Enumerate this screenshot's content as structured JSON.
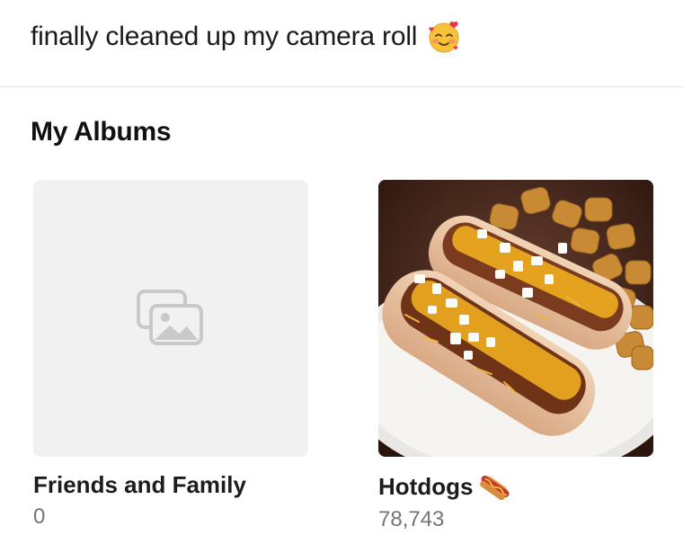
{
  "post": {
    "caption": "finally cleaned up my camera roll",
    "caption_emoji": "smiling-face-with-hearts-icon"
  },
  "albums_section": {
    "title": "My Albums",
    "albums": [
      {
        "name": "Friends and Family",
        "count": "0",
        "thumbnail": "empty-placeholder",
        "placeholder_icon": "photo-gallery-icon"
      },
      {
        "name": "Hotdogs",
        "name_emoji": "hotdog-icon",
        "count": "78,743",
        "thumbnail": "photo of chili cheese hotdogs with tater tots"
      }
    ]
  },
  "colors": {
    "background": "#ffffff",
    "placeholder_bg": "#f1f1f1",
    "count_text": "#757575",
    "divider": "#e2e2e2"
  }
}
